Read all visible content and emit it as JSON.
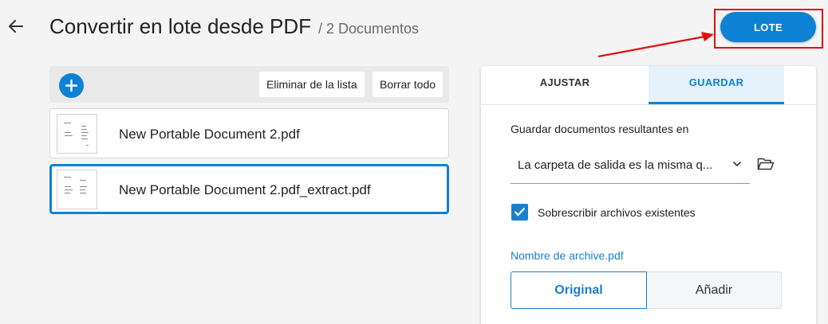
{
  "header": {
    "title": "Convertir en lote desde PDF",
    "doc_count": "/ 2 Documentos",
    "batch_button": "LOTE"
  },
  "toolbar": {
    "remove_from_list": "Eliminar de la lista",
    "clear_all": "Borrar todo"
  },
  "files": [
    {
      "name": "New Portable Document 2.pdf",
      "selected": false
    },
    {
      "name": "New Portable Document 2.pdf_extract.pdf",
      "selected": true
    }
  ],
  "panel": {
    "tabs": [
      "AJUSTAR",
      "GUARDAR"
    ],
    "active_tab": "GUARDAR",
    "save_location_label": "Guardar documentos resultantes en",
    "save_location_value": "La carpeta de salida es la misma q...",
    "overwrite_label": "Sobrescribir archivos existentes",
    "overwrite_checked": true,
    "filename_label": "Nombre de archive.pdf",
    "filename_options": [
      "Original",
      "Añadir"
    ],
    "filename_selected": "Original"
  },
  "colors": {
    "accent": "#0d82d5",
    "annotation": "#e01010"
  },
  "icons": [
    "back-arrow-icon",
    "plus-icon",
    "chevron-down-icon",
    "folder-open-icon",
    "checkmark-icon"
  ]
}
